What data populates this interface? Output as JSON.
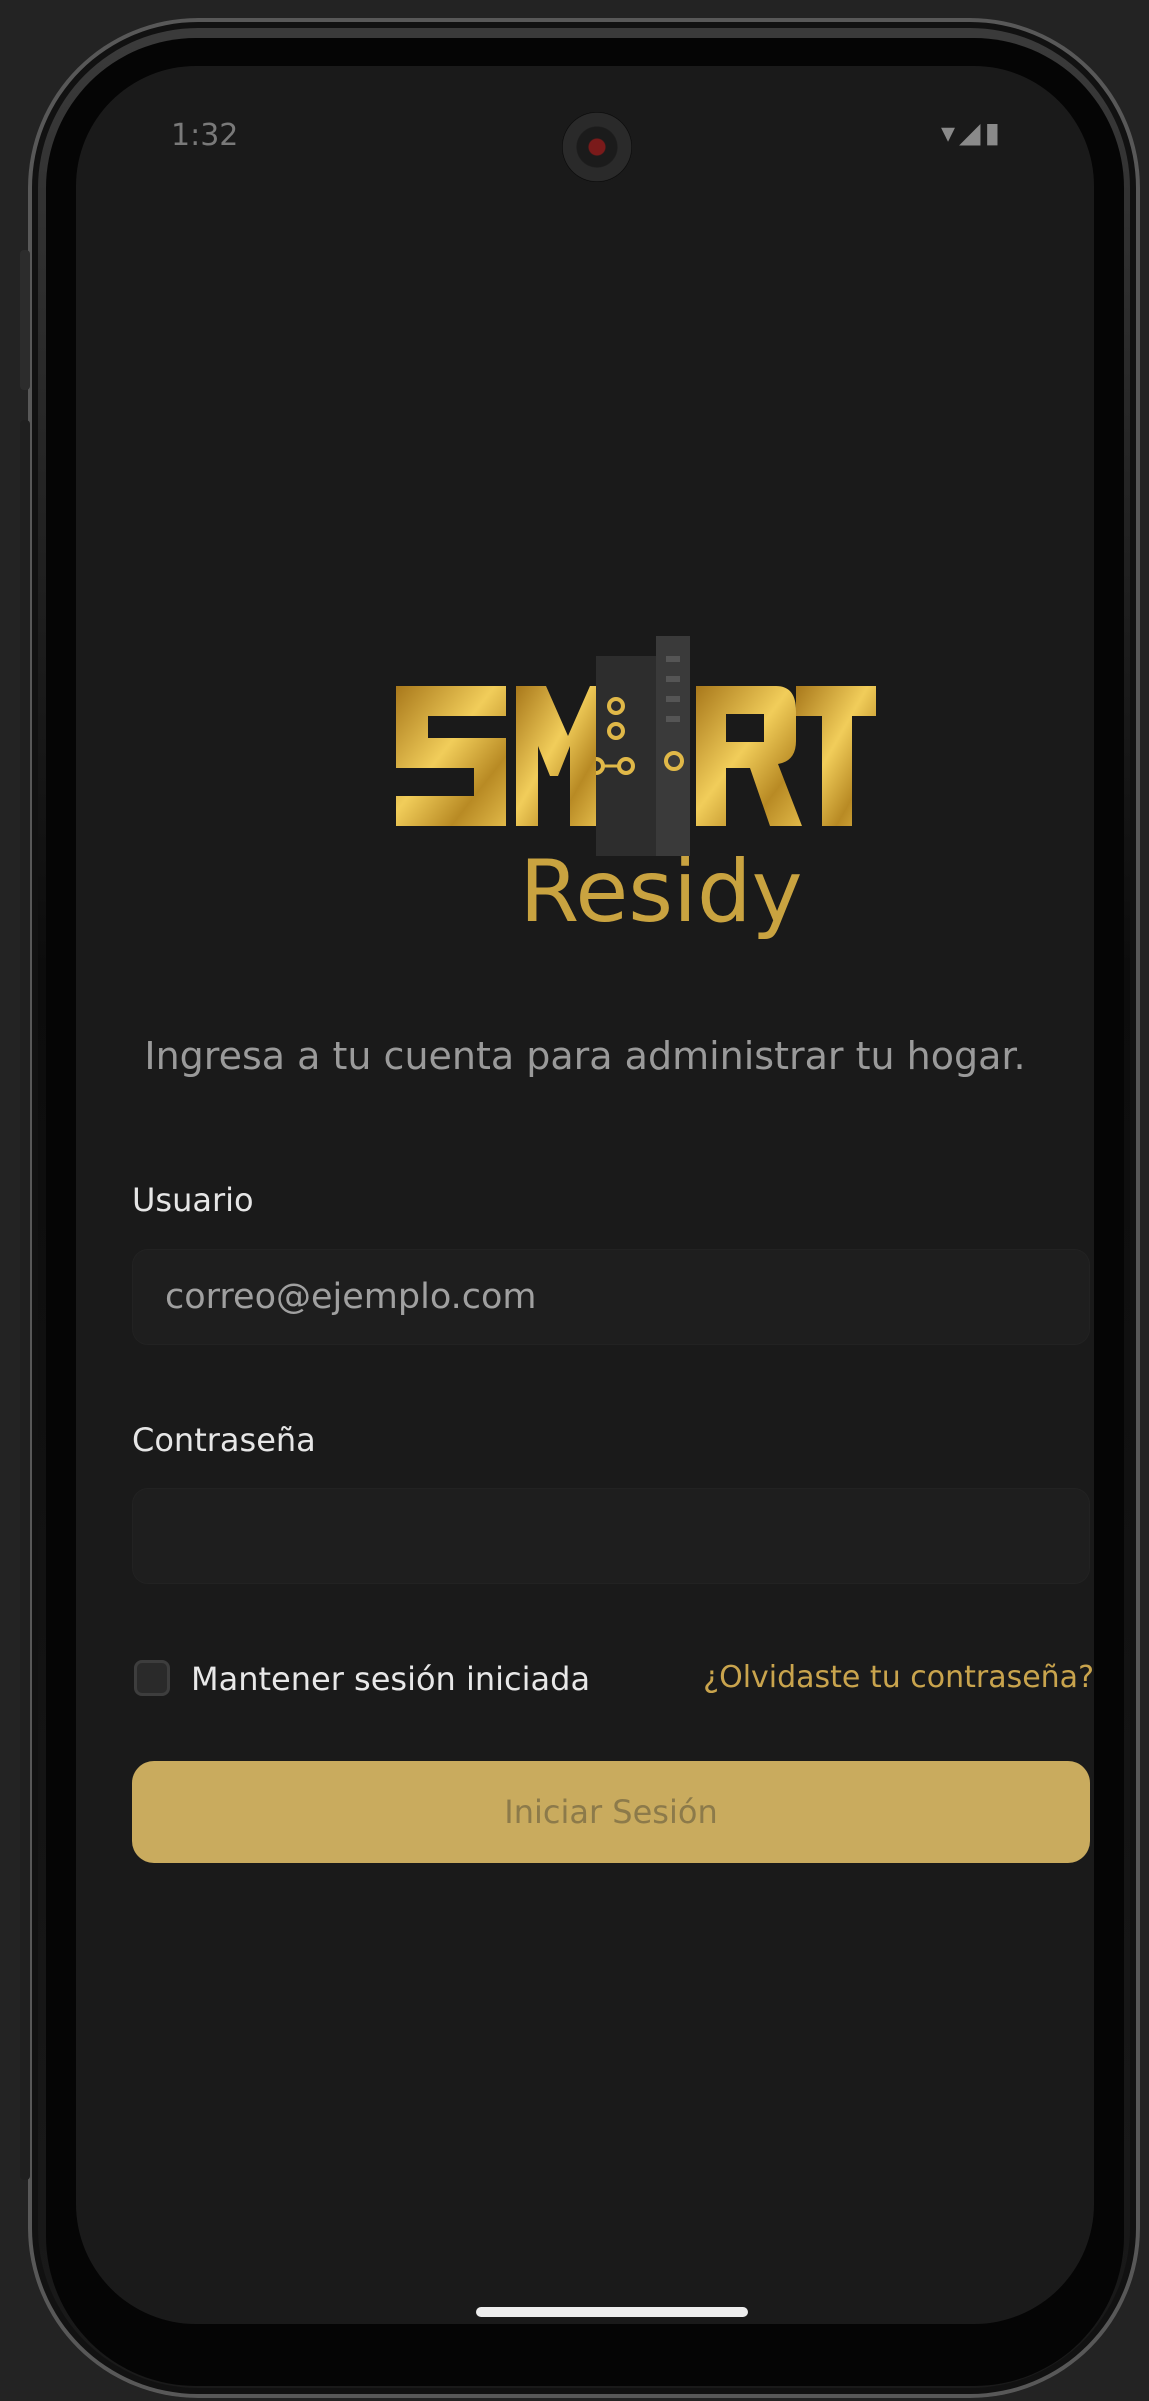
{
  "status_bar": {
    "time": "1:32",
    "icons": "▾◢▮"
  },
  "brand": {
    "logo_text": "SMART",
    "logo_subtitle": "Residy"
  },
  "tagline": "Ingresa a tu cuenta para administrar tu hogar.",
  "form": {
    "user_label": "Usuario",
    "user_placeholder": "correo@ejemplo.com",
    "password_label": "Contraseña",
    "password_placeholder": "",
    "remember_label": "Mantener sesión iniciada",
    "remember_checked": false,
    "forgot_label": "¿Olvidaste tu contraseña?",
    "submit_label": "Iniciar Sesión"
  },
  "colors": {
    "accent": "#c9ab5e",
    "link": "#c9a44d",
    "background": "#1a1a1a"
  }
}
